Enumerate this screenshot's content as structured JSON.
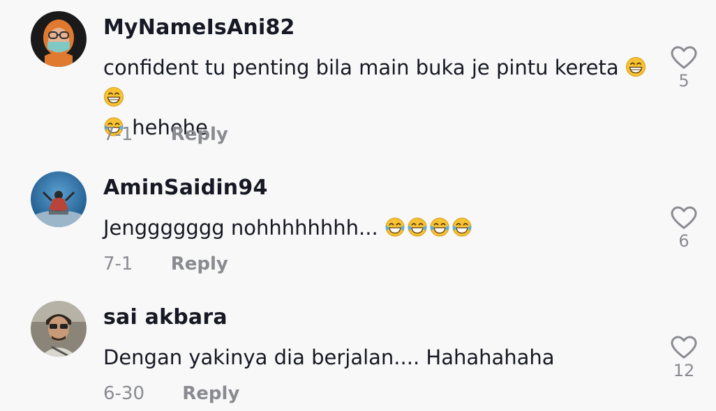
{
  "comments": [
    {
      "username": "MyNameIsAni82",
      "text_main": "confident tu penting bila main buka je pintu kereta ",
      "text_tail": " hehehe",
      "date": "7-1",
      "reply_label": "Reply",
      "likes": "5"
    },
    {
      "username": "AminSaidin94",
      "text_main": "Jenggggggg nohhhhhhhh... ",
      "date": "7-1",
      "reply_label": "Reply",
      "likes": "6"
    },
    {
      "username": "sai akbara",
      "text_main": "Dengan yakinya dia berjalan.... Hahahahaha",
      "date": "6-30",
      "reply_label": "Reply",
      "likes": "12"
    }
  ],
  "icons": {
    "like": "heart-outline-icon",
    "grin": "grinning-face-emoji",
    "tears": "tears-of-joy-emoji"
  },
  "colors": {
    "background": "#f8f8f8",
    "text": "#161823",
    "muted": "#8a8b91"
  }
}
